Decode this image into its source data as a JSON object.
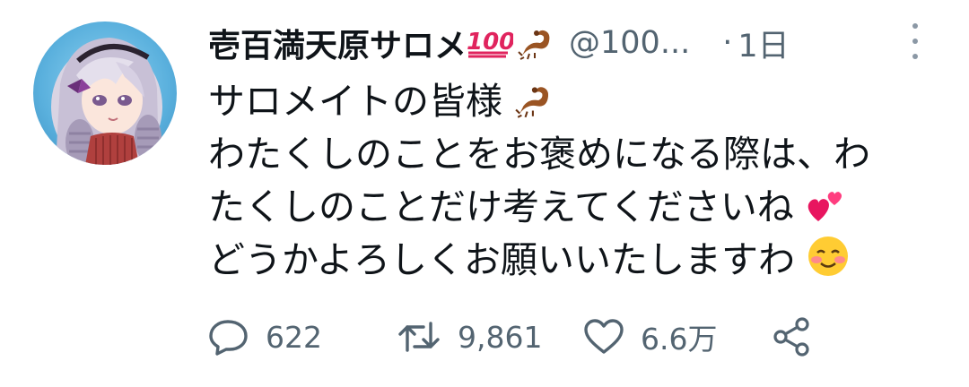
{
  "tweet": {
    "author": {
      "display_name": "壱百満天原サロメ",
      "name_emojis": [
        "hundred-points-emoji",
        "scorpion-emoji"
      ],
      "handle": "@100...",
      "avatar": "avatar"
    },
    "separator": "·",
    "timestamp": "1日",
    "more_icon": "more-vertical-icon",
    "text_lines": [
      "サロメイトの皆様",
      "わたくしのことをお褒めになる際は、わ",
      "たくしのことだけ考えてくださいね",
      "どうかよろしくお願いいたしますわ"
    ],
    "line_emojis": [
      "scorpion-emoji",
      "",
      "two-hearts-emoji",
      "smiling-face-emoji"
    ],
    "actions": {
      "reply": {
        "icon": "reply-icon",
        "count": "622"
      },
      "retweet": {
        "icon": "retweet-icon",
        "count": "9,861"
      },
      "like": {
        "icon": "heart-icon",
        "count": "6.6万"
      },
      "share": {
        "icon": "share-icon"
      }
    }
  },
  "colors": {
    "text": "#0f1419",
    "secondary": "#536471",
    "icon": "#536471",
    "emoji_100": "#e0245e",
    "scorpion": "#8a4a1c",
    "hearts": "#e8155f"
  }
}
